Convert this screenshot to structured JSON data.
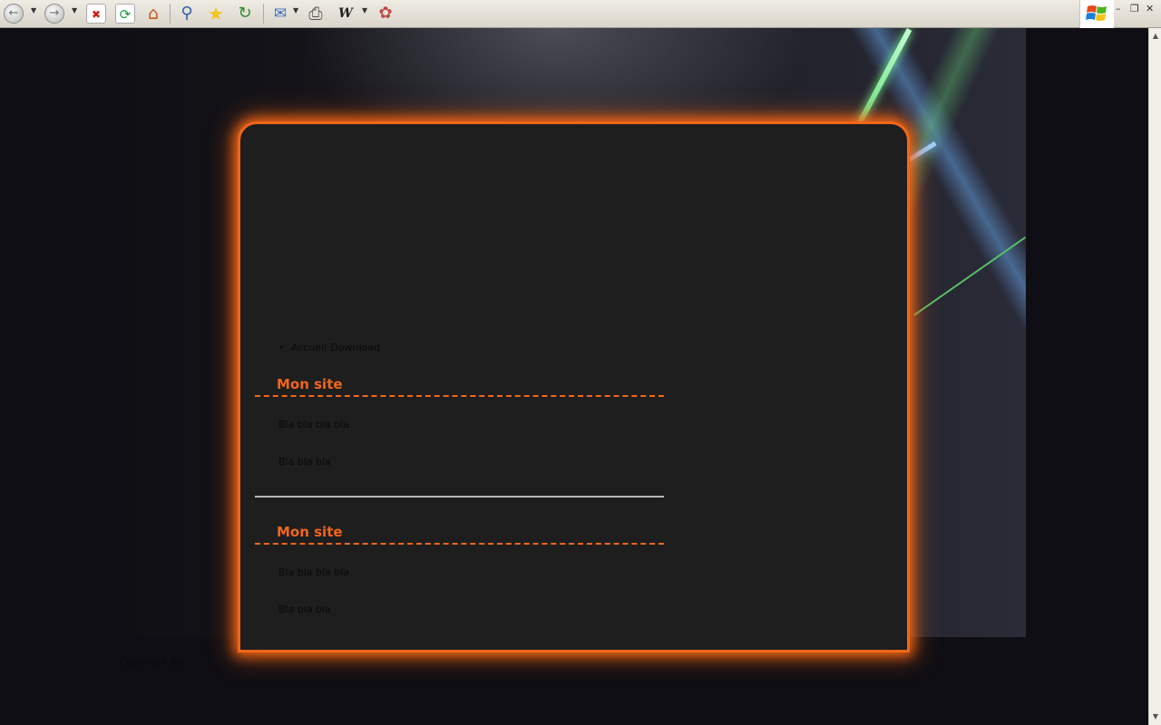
{
  "toolbar": {
    "buttons": [
      {
        "icon": "back-arrow-icon",
        "glyph": "←"
      },
      {
        "icon": "forward-arrow-icon",
        "glyph": "→"
      },
      {
        "icon": "stop-icon",
        "glyph": "✖"
      },
      {
        "icon": "refresh-icon",
        "glyph": "⟳"
      },
      {
        "icon": "home-icon",
        "glyph": "⌂"
      },
      {
        "icon": "search-icon",
        "glyph": "⚲"
      },
      {
        "icon": "favorites-star-icon",
        "glyph": "★"
      },
      {
        "icon": "history-icon",
        "glyph": "↻"
      },
      {
        "icon": "mail-icon",
        "glyph": "✉"
      },
      {
        "icon": "print-icon",
        "glyph": "⎙"
      },
      {
        "icon": "word-edit-icon",
        "glyph": "W"
      },
      {
        "icon": "messenger-icon",
        "glyph": "✿"
      }
    ]
  },
  "nav": {
    "items": [
      "Accueil",
      "Download"
    ]
  },
  "sections": [
    {
      "title": "Mon site",
      "paragraphs": [
        "Bla bla bla bla",
        "Bla bla bla"
      ]
    },
    {
      "title": "Mon site",
      "paragraphs": [
        "Bla bla bla bla",
        "Bla bla bla"
      ]
    }
  ],
  "footer": {
    "text": "Copyright by"
  },
  "colors": {
    "accent": "#f0661a",
    "card_bg": "#1e1e1f",
    "page_bg": "#0e0e14"
  }
}
